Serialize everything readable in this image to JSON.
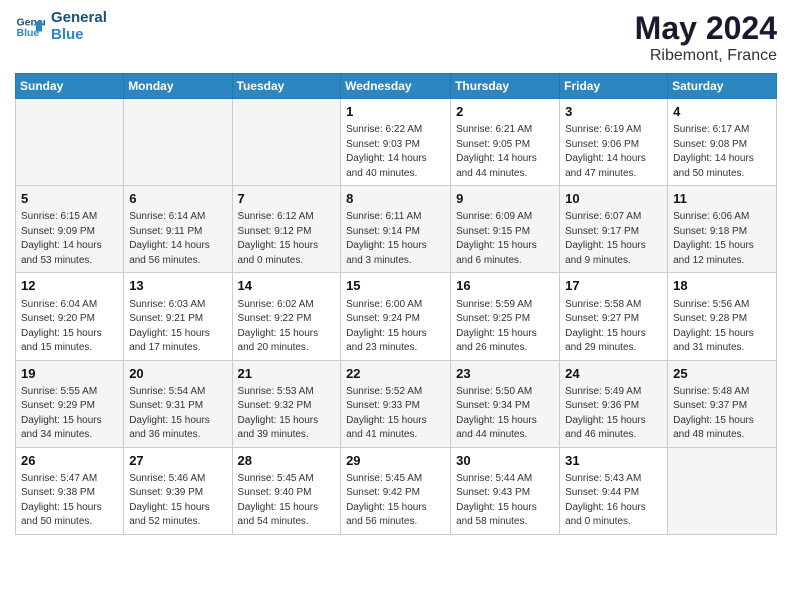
{
  "header": {
    "logo_line1": "General",
    "logo_line2": "Blue",
    "month": "May 2024",
    "location": "Ribemont, France"
  },
  "weekdays": [
    "Sunday",
    "Monday",
    "Tuesday",
    "Wednesday",
    "Thursday",
    "Friday",
    "Saturday"
  ],
  "weeks": [
    [
      {
        "day": "",
        "info": ""
      },
      {
        "day": "",
        "info": ""
      },
      {
        "day": "",
        "info": ""
      },
      {
        "day": "1",
        "info": "Sunrise: 6:22 AM\nSunset: 9:03 PM\nDaylight: 14 hours\nand 40 minutes."
      },
      {
        "day": "2",
        "info": "Sunrise: 6:21 AM\nSunset: 9:05 PM\nDaylight: 14 hours\nand 44 minutes."
      },
      {
        "day": "3",
        "info": "Sunrise: 6:19 AM\nSunset: 9:06 PM\nDaylight: 14 hours\nand 47 minutes."
      },
      {
        "day": "4",
        "info": "Sunrise: 6:17 AM\nSunset: 9:08 PM\nDaylight: 14 hours\nand 50 minutes."
      }
    ],
    [
      {
        "day": "5",
        "info": "Sunrise: 6:15 AM\nSunset: 9:09 PM\nDaylight: 14 hours\nand 53 minutes."
      },
      {
        "day": "6",
        "info": "Sunrise: 6:14 AM\nSunset: 9:11 PM\nDaylight: 14 hours\nand 56 minutes."
      },
      {
        "day": "7",
        "info": "Sunrise: 6:12 AM\nSunset: 9:12 PM\nDaylight: 15 hours\nand 0 minutes."
      },
      {
        "day": "8",
        "info": "Sunrise: 6:11 AM\nSunset: 9:14 PM\nDaylight: 15 hours\nand 3 minutes."
      },
      {
        "day": "9",
        "info": "Sunrise: 6:09 AM\nSunset: 9:15 PM\nDaylight: 15 hours\nand 6 minutes."
      },
      {
        "day": "10",
        "info": "Sunrise: 6:07 AM\nSunset: 9:17 PM\nDaylight: 15 hours\nand 9 minutes."
      },
      {
        "day": "11",
        "info": "Sunrise: 6:06 AM\nSunset: 9:18 PM\nDaylight: 15 hours\nand 12 minutes."
      }
    ],
    [
      {
        "day": "12",
        "info": "Sunrise: 6:04 AM\nSunset: 9:20 PM\nDaylight: 15 hours\nand 15 minutes."
      },
      {
        "day": "13",
        "info": "Sunrise: 6:03 AM\nSunset: 9:21 PM\nDaylight: 15 hours\nand 17 minutes."
      },
      {
        "day": "14",
        "info": "Sunrise: 6:02 AM\nSunset: 9:22 PM\nDaylight: 15 hours\nand 20 minutes."
      },
      {
        "day": "15",
        "info": "Sunrise: 6:00 AM\nSunset: 9:24 PM\nDaylight: 15 hours\nand 23 minutes."
      },
      {
        "day": "16",
        "info": "Sunrise: 5:59 AM\nSunset: 9:25 PM\nDaylight: 15 hours\nand 26 minutes."
      },
      {
        "day": "17",
        "info": "Sunrise: 5:58 AM\nSunset: 9:27 PM\nDaylight: 15 hours\nand 29 minutes."
      },
      {
        "day": "18",
        "info": "Sunrise: 5:56 AM\nSunset: 9:28 PM\nDaylight: 15 hours\nand 31 minutes."
      }
    ],
    [
      {
        "day": "19",
        "info": "Sunrise: 5:55 AM\nSunset: 9:29 PM\nDaylight: 15 hours\nand 34 minutes."
      },
      {
        "day": "20",
        "info": "Sunrise: 5:54 AM\nSunset: 9:31 PM\nDaylight: 15 hours\nand 36 minutes."
      },
      {
        "day": "21",
        "info": "Sunrise: 5:53 AM\nSunset: 9:32 PM\nDaylight: 15 hours\nand 39 minutes."
      },
      {
        "day": "22",
        "info": "Sunrise: 5:52 AM\nSunset: 9:33 PM\nDaylight: 15 hours\nand 41 minutes."
      },
      {
        "day": "23",
        "info": "Sunrise: 5:50 AM\nSunset: 9:34 PM\nDaylight: 15 hours\nand 44 minutes."
      },
      {
        "day": "24",
        "info": "Sunrise: 5:49 AM\nSunset: 9:36 PM\nDaylight: 15 hours\nand 46 minutes."
      },
      {
        "day": "25",
        "info": "Sunrise: 5:48 AM\nSunset: 9:37 PM\nDaylight: 15 hours\nand 48 minutes."
      }
    ],
    [
      {
        "day": "26",
        "info": "Sunrise: 5:47 AM\nSunset: 9:38 PM\nDaylight: 15 hours\nand 50 minutes."
      },
      {
        "day": "27",
        "info": "Sunrise: 5:46 AM\nSunset: 9:39 PM\nDaylight: 15 hours\nand 52 minutes."
      },
      {
        "day": "28",
        "info": "Sunrise: 5:45 AM\nSunset: 9:40 PM\nDaylight: 15 hours\nand 54 minutes."
      },
      {
        "day": "29",
        "info": "Sunrise: 5:45 AM\nSunset: 9:42 PM\nDaylight: 15 hours\nand 56 minutes."
      },
      {
        "day": "30",
        "info": "Sunrise: 5:44 AM\nSunset: 9:43 PM\nDaylight: 15 hours\nand 58 minutes."
      },
      {
        "day": "31",
        "info": "Sunrise: 5:43 AM\nSunset: 9:44 PM\nDaylight: 16 hours\nand 0 minutes."
      },
      {
        "day": "",
        "info": ""
      }
    ]
  ]
}
